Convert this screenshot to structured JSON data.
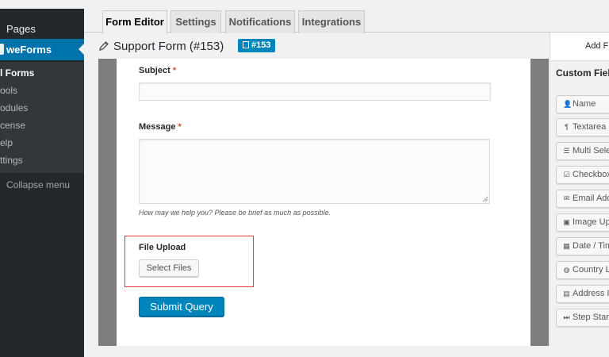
{
  "sidebar": {
    "pages_label": "Pages",
    "active_label": "weForms",
    "submenu": [
      {
        "label": "l Forms",
        "current": true
      },
      {
        "label": "ools",
        "current": false
      },
      {
        "label": "odules",
        "current": false
      },
      {
        "label": "cense",
        "current": false
      },
      {
        "label": "elp",
        "current": false
      },
      {
        "label": "ttings",
        "current": false
      }
    ],
    "collapse_label": "Collapse menu"
  },
  "tabs": [
    {
      "label": "Form Editor",
      "active": true
    },
    {
      "label": "Settings",
      "active": false
    },
    {
      "label": "Notifications",
      "active": false
    },
    {
      "label": "Integrations",
      "active": false
    }
  ],
  "header": {
    "title": "Support Form (#153)",
    "badge": "#153"
  },
  "form": {
    "subject_label": "Subject",
    "message_label": "Message",
    "required_mark": "*",
    "message_help": "How may we help you? Please be brief as much as possible.",
    "file_upload_label": "File Upload",
    "select_files_label": "Select Files",
    "submit_label": "Submit Query"
  },
  "right_panel": {
    "tab_label": "Add Fi",
    "heading": "Custom Fiel",
    "fields": [
      {
        "icon": "user-icon",
        "glyph": "👤",
        "label": "Name"
      },
      {
        "icon": "paragraph-icon",
        "glyph": "¶",
        "label": "Textarea"
      },
      {
        "icon": "list-icon",
        "glyph": "☰",
        "label": "Multi Sele"
      },
      {
        "icon": "checkbox-icon",
        "glyph": "☑",
        "label": "Checkbox"
      },
      {
        "icon": "envelope-icon",
        "glyph": "✉",
        "label": "Email Ado"
      },
      {
        "icon": "image-icon",
        "glyph": "▣",
        "label": "Image Up"
      },
      {
        "icon": "calendar-icon",
        "glyph": "▦",
        "label": "Date / Tim"
      },
      {
        "icon": "globe-icon",
        "glyph": "◍",
        "label": "Country L"
      },
      {
        "icon": "address-card-icon",
        "glyph": "▤",
        "label": "Address I"
      },
      {
        "icon": "step-forward-icon",
        "glyph": "⏭",
        "label": "Step Start"
      }
    ]
  },
  "colors": {
    "sidebar_bg": "#23282d",
    "active_menu": "#0073aa",
    "primary_button": "#0085ba",
    "required": "#d54e21",
    "highlight_box": "#e53935"
  }
}
